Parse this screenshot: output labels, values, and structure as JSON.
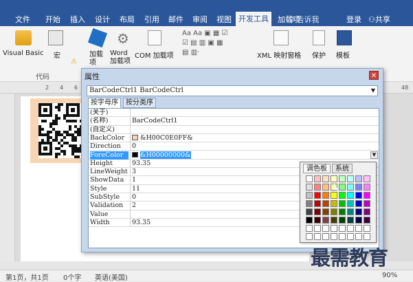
{
  "ribbon_tabs": [
    "文件",
    "开始",
    "插入",
    "设计",
    "布局",
    "引用",
    "邮件",
    "审阅",
    "视图",
    "开发工具",
    "加载项"
  ],
  "active_tab": "开发工具",
  "tell_me": "告诉我",
  "login": "登录",
  "share": "共享",
  "ribbon": {
    "visual_basic": "Visual Basic",
    "macro": "宏",
    "add_in": "加载项",
    "word_add_in": "Word 加载项",
    "com_add_in": "COM 加载项",
    "xml_pane": "XML 映射窗格",
    "protect": "保护",
    "template": "模板",
    "group_code": "代码"
  },
  "ruler_ticks": [
    "2",
    "4",
    "6",
    "48"
  ],
  "dialog": {
    "title": "属性",
    "object": "BarCodeCtrl1 BarCodeCtrl",
    "tab_alpha": "按字母序",
    "tab_category": "按分类序",
    "properties": [
      {
        "name": "(关于)",
        "value": ""
      },
      {
        "name": "(名称)",
        "value": "BarCodeCtrl1"
      },
      {
        "name": "(自定义)",
        "value": ""
      },
      {
        "name": "BackColor",
        "value": "&H00C0E0FF&",
        "swatch": "#f7d5b3"
      },
      {
        "name": "Direction",
        "value": "0"
      },
      {
        "name": "ForeColor",
        "value": "&H00000000&",
        "swatch": "#000000",
        "selected": true
      },
      {
        "name": "Height",
        "value": "93.35"
      },
      {
        "name": "LineWeight",
        "value": "3"
      },
      {
        "name": "ShowData",
        "value": "1"
      },
      {
        "name": "Style",
        "value": "11"
      },
      {
        "name": "SubStyle",
        "value": "0"
      },
      {
        "name": "Validation",
        "value": "2"
      },
      {
        "name": "Value",
        "value": ""
      },
      {
        "name": "Width",
        "value": "93.35"
      }
    ]
  },
  "palette": {
    "tab_palette": "调色板",
    "tab_system": "系统",
    "colors": [
      "#ffffff",
      "#ffc0c0",
      "#ffe0c0",
      "#ffffc0",
      "#c0ffc0",
      "#c0ffff",
      "#c0c0ff",
      "#ffc0ff",
      "#e0e0e0",
      "#ff8080",
      "#ffc080",
      "#ffff80",
      "#80ff80",
      "#80ffff",
      "#8080ff",
      "#ff80ff",
      "#c0c0c0",
      "#ff0000",
      "#ff8000",
      "#ffff00",
      "#00ff00",
      "#00ffff",
      "#0000ff",
      "#ff00ff",
      "#808080",
      "#c00000",
      "#c04000",
      "#c0c000",
      "#00c000",
      "#00c0c0",
      "#0000c0",
      "#c000c0",
      "#404040",
      "#800000",
      "#804000",
      "#808000",
      "#008000",
      "#008080",
      "#000080",
      "#800080",
      "#000000",
      "#400000",
      "#804040",
      "#404000",
      "#004000",
      "#004040",
      "#000040",
      "#400040",
      "#ffffff",
      "#ffffff",
      "#ffffff",
      "#ffffff",
      "#ffffff",
      "#ffffff",
      "#ffffff",
      "#ffffff",
      "#ffffff",
      "#ffffff",
      "#ffffff",
      "#ffffff",
      "#ffffff",
      "#ffffff",
      "#ffffff",
      "#ffffff"
    ]
  },
  "status": {
    "page": "第1页，共1页",
    "words": "0个字",
    "lang": "英语(美国)",
    "zoom": "90%"
  },
  "watermark": "最需教育"
}
